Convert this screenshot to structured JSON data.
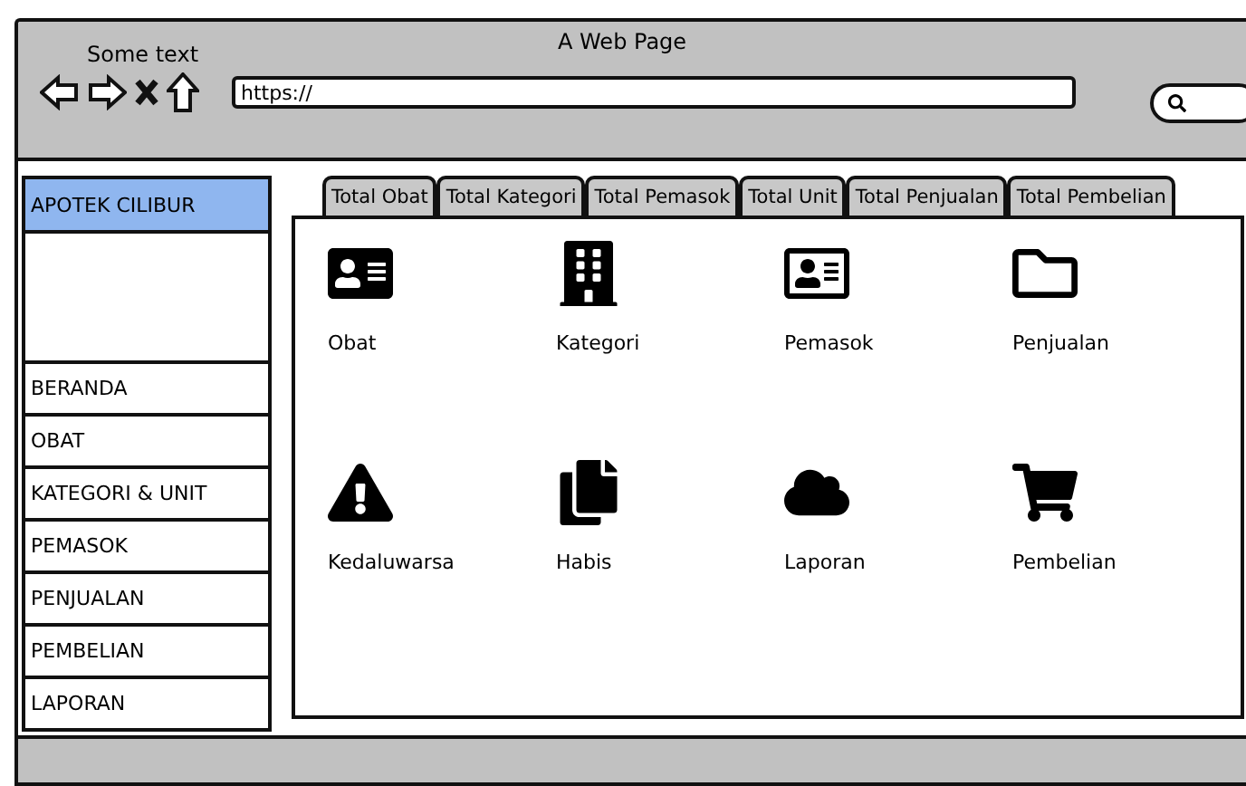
{
  "window": {
    "title": "A Web Page",
    "caption": "Some text"
  },
  "address_bar": {
    "value": "https://"
  },
  "sidebar": {
    "title": "APOTEK CILIBUR",
    "items": [
      {
        "label": "BERANDA"
      },
      {
        "label": "OBAT"
      },
      {
        "label": "KATEGORI & UNIT"
      },
      {
        "label": "PEMASOK"
      },
      {
        "label": "PENJUALAN"
      },
      {
        "label": "PEMBELIAN"
      },
      {
        "label": "LAPORAN"
      }
    ]
  },
  "tabs": [
    {
      "label": "Total Obat"
    },
    {
      "label": "Total Kategori"
    },
    {
      "label": "Total Pemasok"
    },
    {
      "label": "Total Unit"
    },
    {
      "label": "Total Penjualan"
    },
    {
      "label": "Total Pembelian"
    }
  ],
  "tiles": [
    {
      "label": "Obat"
    },
    {
      "label": "Kategori"
    },
    {
      "label": "Pemasok"
    },
    {
      "label": "Penjualan"
    },
    {
      "label": "Kedaluwarsa"
    },
    {
      "label": "Habis"
    },
    {
      "label": "Laporan"
    },
    {
      "label": "Pembelian"
    }
  ]
}
